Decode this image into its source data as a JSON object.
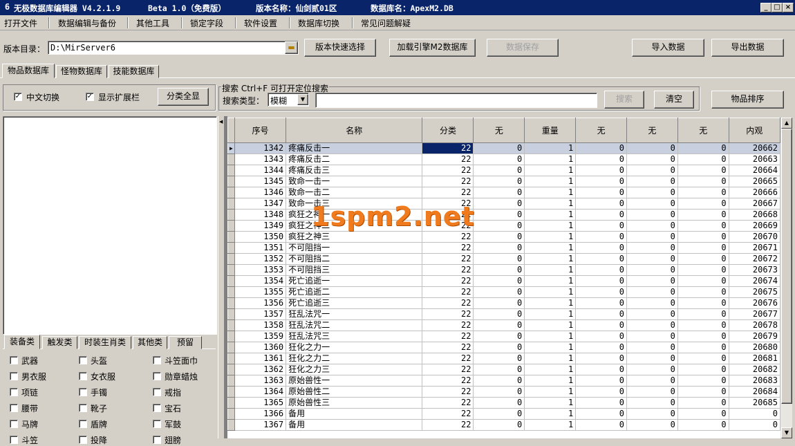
{
  "titlebar": {
    "app": "无极数据库编辑器 V4.2.1.9",
    "beta": "Beta 1.0（免费版）",
    "version_name": "版本名称：仙剑贰01区",
    "db_name": "数据库名：ApexM2.DB",
    "min": "_",
    "max": "□",
    "close": "×"
  },
  "menu": [
    "打开文件",
    "数据编辑与备份",
    "其他工具",
    "锁定字段",
    "软件设置",
    "数据库切换",
    "常见问题解疑"
  ],
  "toolbar": {
    "dir_label": "版本目录：",
    "dir_value": "D:\\MirServer6",
    "quick_select": "版本快速选择",
    "load_engine": "加载引擎M2数据库",
    "save_data": "数据保存",
    "import": "导入数据",
    "export": "导出数据"
  },
  "tabs": [
    "物品数据库",
    "怪物数据库",
    "技能数据库"
  ],
  "options": {
    "chinese_toggle": "中文切换",
    "show_ext": "显示扩展栏",
    "classify_all": "分类全显"
  },
  "search": {
    "title": "搜索  Ctrl+F 可打开定位搜索",
    "type_label": "搜索类型：",
    "type_value": "模糊",
    "button": "搜索",
    "clear": "清空",
    "sort": "物品排序"
  },
  "category_tabs": [
    "装备类",
    "触发类",
    "时装生肖类",
    "其他类",
    "预留"
  ],
  "category_items": [
    [
      "武器",
      "头盔",
      "斗笠面巾"
    ],
    [
      "男衣服",
      "女衣服",
      "勋章蜡烛"
    ],
    [
      "项链",
      "手镯",
      "戒指"
    ],
    [
      "腰带",
      "靴子",
      "宝石"
    ],
    [
      "马牌",
      "盾牌",
      "军鼓"
    ],
    [
      "斗笠",
      "投降",
      "翅膀"
    ]
  ],
  "grid": {
    "columns": [
      "序号",
      "名称",
      "分类",
      "无",
      "重量",
      "无",
      "无",
      "无",
      "内观"
    ],
    "rows": [
      [
        "1342",
        "疼痛反击一",
        "22",
        "0",
        "1",
        "0",
        "0",
        "0",
        "20662"
      ],
      [
        "1343",
        "疼痛反击二",
        "22",
        "0",
        "1",
        "0",
        "0",
        "0",
        "20663"
      ],
      [
        "1344",
        "疼痛反击三",
        "22",
        "0",
        "1",
        "0",
        "0",
        "0",
        "20664"
      ],
      [
        "1345",
        "致命一击一",
        "22",
        "0",
        "1",
        "0",
        "0",
        "0",
        "20665"
      ],
      [
        "1346",
        "致命一击二",
        "22",
        "0",
        "1",
        "0",
        "0",
        "0",
        "20666"
      ],
      [
        "1347",
        "致命一击三",
        "22",
        "0",
        "1",
        "0",
        "0",
        "0",
        "20667"
      ],
      [
        "1348",
        "疯狂之神一",
        "22",
        "0",
        "1",
        "0",
        "0",
        "0",
        "20668"
      ],
      [
        "1349",
        "疯狂之神二",
        "22",
        "0",
        "1",
        "0",
        "0",
        "0",
        "20669"
      ],
      [
        "1350",
        "疯狂之神三",
        "22",
        "0",
        "1",
        "0",
        "0",
        "0",
        "20670"
      ],
      [
        "1351",
        "不可阻挡一",
        "22",
        "0",
        "1",
        "0",
        "0",
        "0",
        "20671"
      ],
      [
        "1352",
        "不可阻挡二",
        "22",
        "0",
        "1",
        "0",
        "0",
        "0",
        "20672"
      ],
      [
        "1353",
        "不可阻挡三",
        "22",
        "0",
        "1",
        "0",
        "0",
        "0",
        "20673"
      ],
      [
        "1354",
        "死亡追逝一",
        "22",
        "0",
        "1",
        "0",
        "0",
        "0",
        "20674"
      ],
      [
        "1355",
        "死亡追逝二",
        "22",
        "0",
        "1",
        "0",
        "0",
        "0",
        "20675"
      ],
      [
        "1356",
        "死亡追逝三",
        "22",
        "0",
        "1",
        "0",
        "0",
        "0",
        "20676"
      ],
      [
        "1357",
        "狂乱法咒一",
        "22",
        "0",
        "1",
        "0",
        "0",
        "0",
        "20677"
      ],
      [
        "1358",
        "狂乱法咒二",
        "22",
        "0",
        "1",
        "0",
        "0",
        "0",
        "20678"
      ],
      [
        "1359",
        "狂乱法咒三",
        "22",
        "0",
        "1",
        "0",
        "0",
        "0",
        "20679"
      ],
      [
        "1360",
        "狂化之力一",
        "22",
        "0",
        "1",
        "0",
        "0",
        "0",
        "20680"
      ],
      [
        "1361",
        "狂化之力二",
        "22",
        "0",
        "1",
        "0",
        "0",
        "0",
        "20681"
      ],
      [
        "1362",
        "狂化之力三",
        "22",
        "0",
        "1",
        "0",
        "0",
        "0",
        "20682"
      ],
      [
        "1363",
        "原始兽性一",
        "22",
        "0",
        "1",
        "0",
        "0",
        "0",
        "20683"
      ],
      [
        "1364",
        "原始兽性二",
        "22",
        "0",
        "1",
        "0",
        "0",
        "0",
        "20684"
      ],
      [
        "1365",
        "原始兽性三",
        "22",
        "0",
        "1",
        "0",
        "0",
        "0",
        "20685"
      ],
      [
        "1366",
        "备用",
        "22",
        "0",
        "1",
        "0",
        "0",
        "0",
        "0"
      ],
      [
        "1367",
        "备用",
        "22",
        "0",
        "1",
        "0",
        "0",
        "0",
        "0"
      ]
    ]
  },
  "watermark": "1spm2.net"
}
